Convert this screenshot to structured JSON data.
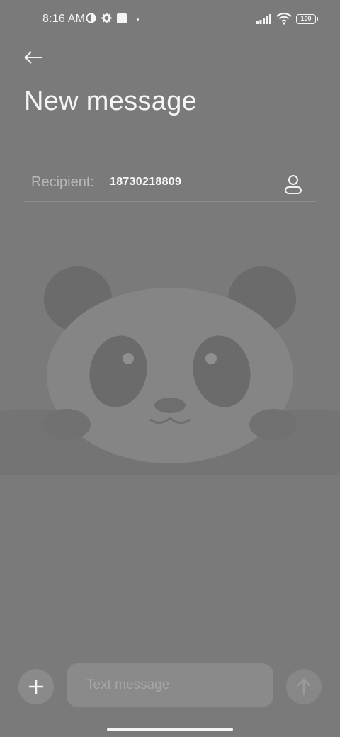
{
  "status_bar": {
    "time": "8:16 AM",
    "battery": "100",
    "icons": [
      "data-saver-icon",
      "gear-icon",
      "square-notification-icon",
      "dot-icon",
      "signal-icon",
      "wifi-icon",
      "battery-icon"
    ]
  },
  "header": {
    "back_icon": "back-arrow-icon",
    "title": "New message"
  },
  "recipient": {
    "label": "Recipient:",
    "value": "18730218809",
    "contact_icon": "contact-person-icon"
  },
  "composer": {
    "add_icon": "plus-icon",
    "placeholder": "Text message",
    "send_icon": "send-arrow-up-icon"
  },
  "colors": {
    "background": "#7a7a7a",
    "text": "#f2f2f2",
    "muted": "#b8b8b8",
    "panda": "#707070"
  }
}
